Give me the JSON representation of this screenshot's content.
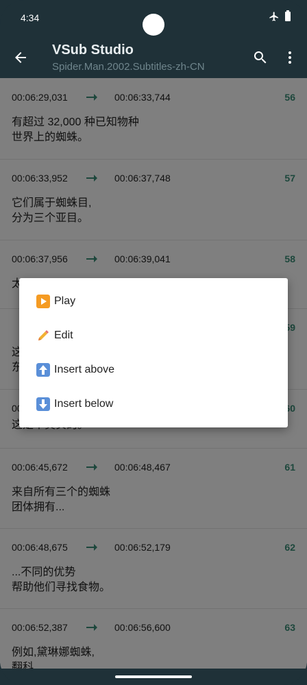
{
  "status": {
    "time": "4:34"
  },
  "appbar": {
    "title": "VSub Studio",
    "subtitle": "Spider.Man.2002.Subtitles-zh-CN"
  },
  "subtitles": [
    {
      "start": "00:06:29,031",
      "end": "00:06:33,744",
      "index": "56",
      "text": "有超过 32,000 种已知物种\n世界上的蜘蛛。"
    },
    {
      "start": "00:06:33,952",
      "end": "00:06:37,748",
      "index": "57",
      "text": "它们属于蜘蛛目,\n分为三个亚目。"
    },
    {
      "start": "00:06:37,956",
      "end": "00:06:39,041",
      "index": "58",
      "text": "太"
    },
    {
      "start": "",
      "end": "",
      "index": "59",
      "text": "这\n东"
    },
    {
      "start": "00:06:",
      "end": "",
      "index": "60",
      "text": "这是不真实的。"
    },
    {
      "start": "00:06:45,672",
      "end": "00:06:48,467",
      "index": "61",
      "text": "来自所有三个的蜘蛛\n团体拥有..."
    },
    {
      "start": "00:06:48,675",
      "end": "00:06:52,179",
      "index": "62",
      "text": "...不同的优势\n帮助他们寻找食物。"
    },
    {
      "start": "00:06:52,387",
      "end": "00:06:56,600",
      "index": "63",
      "text": "例如,黛琳娜蜘蛛,\n翻科"
    }
  ],
  "menu": {
    "items": [
      {
        "label": "Play",
        "icon": "play-button-icon",
        "color": "#f59b23"
      },
      {
        "label": "Edit",
        "icon": "pencil-icon",
        "color": "#e07b3c"
      },
      {
        "label": "Insert above",
        "icon": "up-arrow-icon",
        "color": "#5a8fd8"
      },
      {
        "label": "Insert below",
        "icon": "down-arrow-icon",
        "color": "#5a8fd8"
      }
    ]
  },
  "colors": {
    "appbar": "#1f3138",
    "accent": "#3a8f78"
  }
}
